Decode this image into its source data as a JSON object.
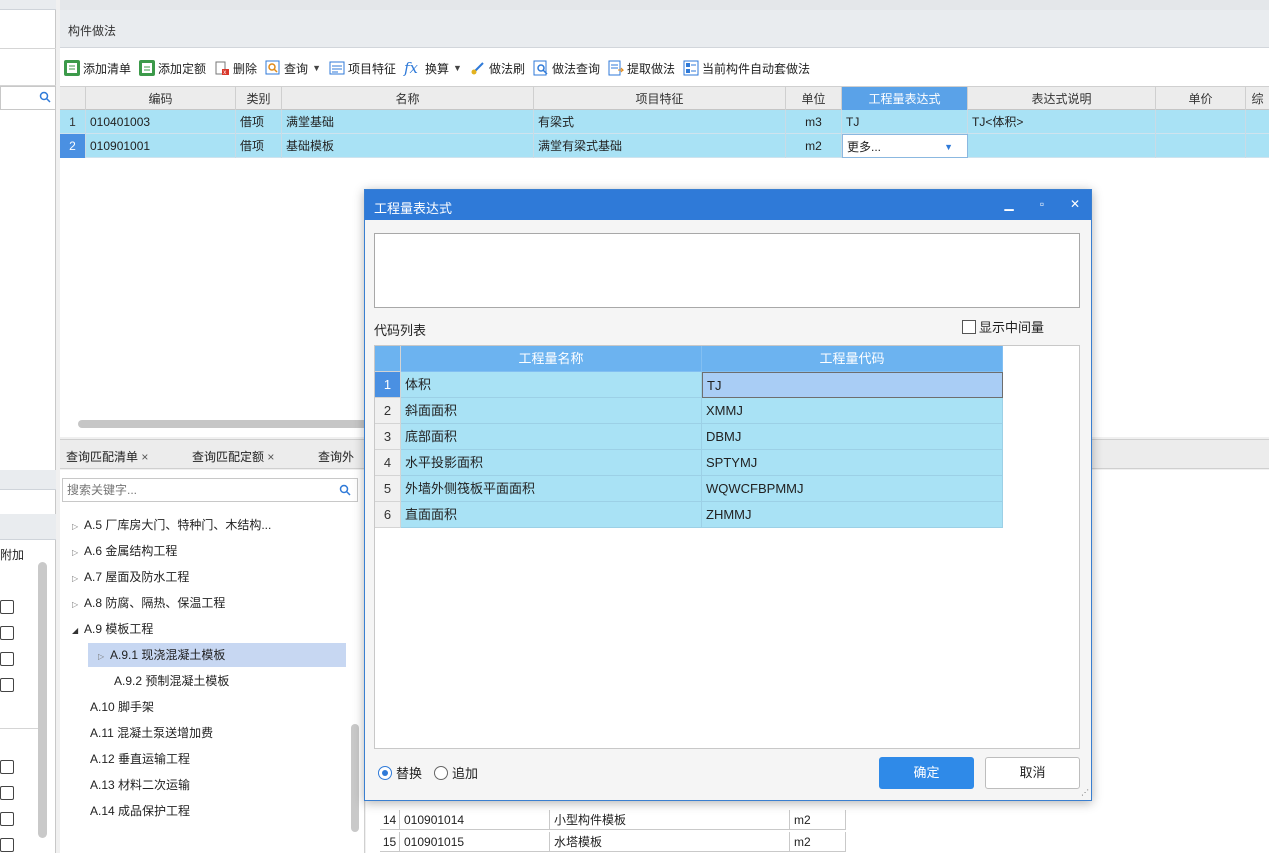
{
  "panel": {
    "title": "构件做法"
  },
  "toolbar": {
    "add_list": "添加清单",
    "add_quota": "添加定额",
    "delete": "删除",
    "query": "查询",
    "item_feature": "项目特征",
    "convert": "换算",
    "method_brush": "做法刷",
    "method_query": "做法查询",
    "extract_method": "提取做法",
    "auto_apply": "当前构件自动套做法"
  },
  "grid": {
    "columns": [
      "编码",
      "类别",
      "名称",
      "项目特征",
      "单位",
      "工程量表达式",
      "表达式说明",
      "单价",
      "综"
    ],
    "rows": [
      {
        "num": "1",
        "code": "010401003",
        "type": "借项",
        "name": "满堂基础",
        "feature": "有梁式",
        "unit": "m3",
        "expr": "TJ",
        "desc": "TJ<体积>"
      },
      {
        "num": "2",
        "code": "010901001",
        "type": "借项",
        "name": "基础模板",
        "feature": "满堂有梁式基础",
        "unit": "m2",
        "expr": "更多...",
        "desc": ""
      }
    ]
  },
  "bottom_tabs": [
    {
      "label": "查询匹配清单",
      "close": "×"
    },
    {
      "label": "查询匹配定额",
      "close": "×"
    },
    {
      "label": "查询外"
    }
  ],
  "tree": {
    "search_placeholder": "搜索关键字...",
    "items": [
      "A.5 厂库房大门、特种门、木结构...",
      "A.6 金属结构工程",
      "A.7 屋面及防水工程",
      "A.8 防腐、隔热、保温工程",
      "A.9 模板工程",
      "A.9.1 现浇混凝土模板",
      "A.9.2 预制混凝土模板",
      "A.10 脚手架",
      "A.11 混凝土泵送增加费",
      "A.12 垂直运输工程",
      "A.13 材料二次运输",
      "A.14 成品保护工程"
    ]
  },
  "left_panel": {
    "col_label": "附加"
  },
  "bottom_table": {
    "rows": [
      {
        "num": "14",
        "code": "010901014",
        "name": "小型构件模板",
        "unit": "m2"
      },
      {
        "num": "15",
        "code": "010901015",
        "name": "水塔模板",
        "unit": "m2"
      }
    ]
  },
  "dialog": {
    "title": "工程量表达式",
    "code_list_label": "代码列表",
    "show_intermediate": "显示中间量",
    "columns": [
      "工程量名称",
      "工程量代码"
    ],
    "rows": [
      {
        "num": "1",
        "name": "体积",
        "code": "TJ"
      },
      {
        "num": "2",
        "name": "斜面面积",
        "code": "XMMJ"
      },
      {
        "num": "3",
        "name": "底部面积",
        "code": "DBMJ"
      },
      {
        "num": "4",
        "name": "水平投影面积",
        "code": "SPTYMJ"
      },
      {
        "num": "5",
        "name": "外墙外侧筏板平面面积",
        "code": "WQWCFBPMMJ"
      },
      {
        "num": "6",
        "name": "直面面积",
        "code": "ZHMMJ"
      }
    ],
    "replace": "替换",
    "append": "追加",
    "ok": "确定",
    "cancel": "取消"
  },
  "colors": {
    "accent": "#2f7ad8",
    "row_fill": "#a9e2f5",
    "header_active": "#5aa2e8"
  }
}
